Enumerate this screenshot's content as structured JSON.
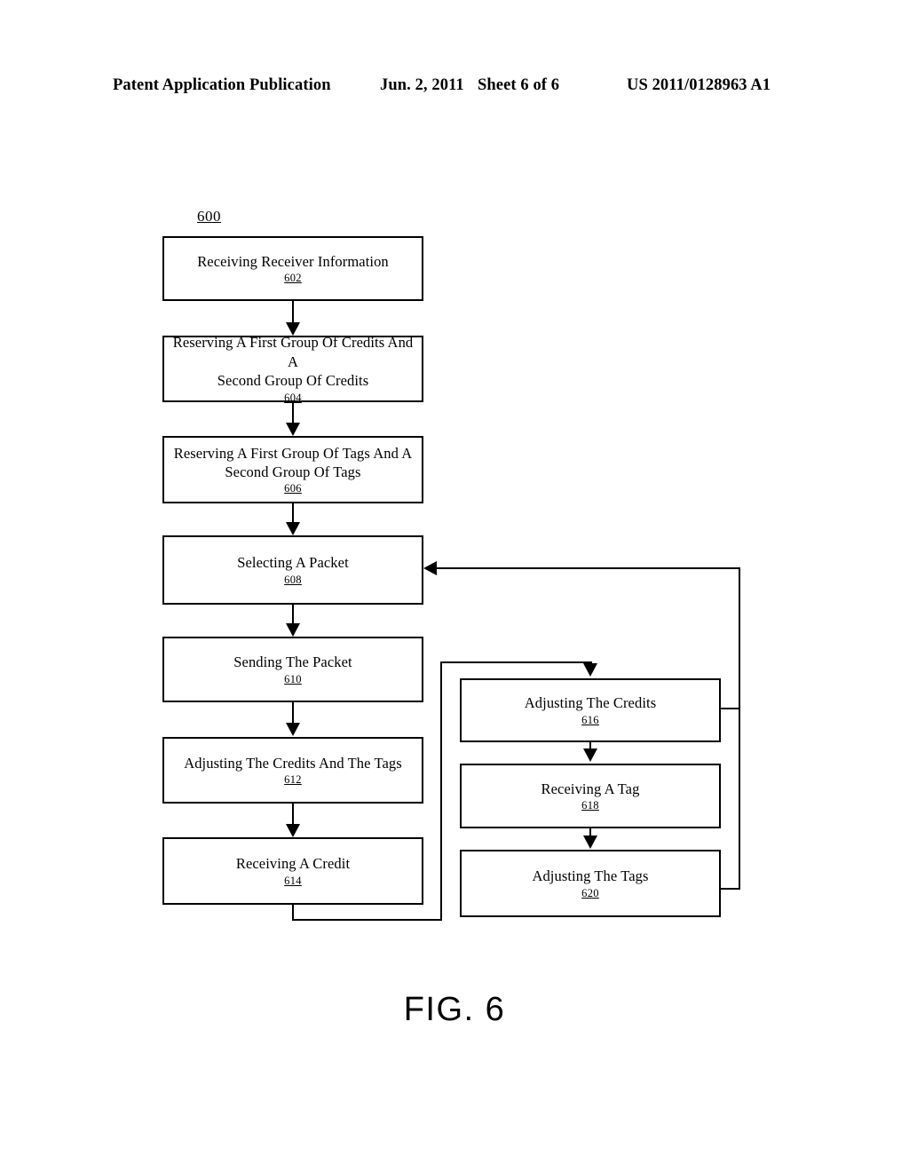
{
  "header": {
    "publication": "Patent Application Publication",
    "date": "Jun. 2, 2011",
    "sheet": "Sheet 6 of 6",
    "patent_number": "US 2011/0128963 A1"
  },
  "figure": {
    "caption": "FIG. 6",
    "flowchart_ref": "600",
    "nodes": [
      {
        "id": "602",
        "label": "Receiving Receiver Information",
        "ref": "602"
      },
      {
        "id": "604",
        "label": "Reserving A First Group Of Credits And A\nSecond Group Of Credits",
        "ref": "604"
      },
      {
        "id": "606",
        "label": "Reserving A First Group Of Tags And A\nSecond Group Of Tags",
        "ref": "606"
      },
      {
        "id": "608",
        "label": "Selecting A Packet",
        "ref": "608"
      },
      {
        "id": "610",
        "label": "Sending The Packet",
        "ref": "610"
      },
      {
        "id": "612",
        "label": "Adjusting The Credits And The Tags",
        "ref": "612"
      },
      {
        "id": "614",
        "label": "Receiving A Credit",
        "ref": "614"
      },
      {
        "id": "616",
        "label": "Adjusting The Credits",
        "ref": "616"
      },
      {
        "id": "618",
        "label": "Receiving A Tag",
        "ref": "618"
      },
      {
        "id": "620",
        "label": "Adjusting The Tags",
        "ref": "620"
      }
    ]
  }
}
